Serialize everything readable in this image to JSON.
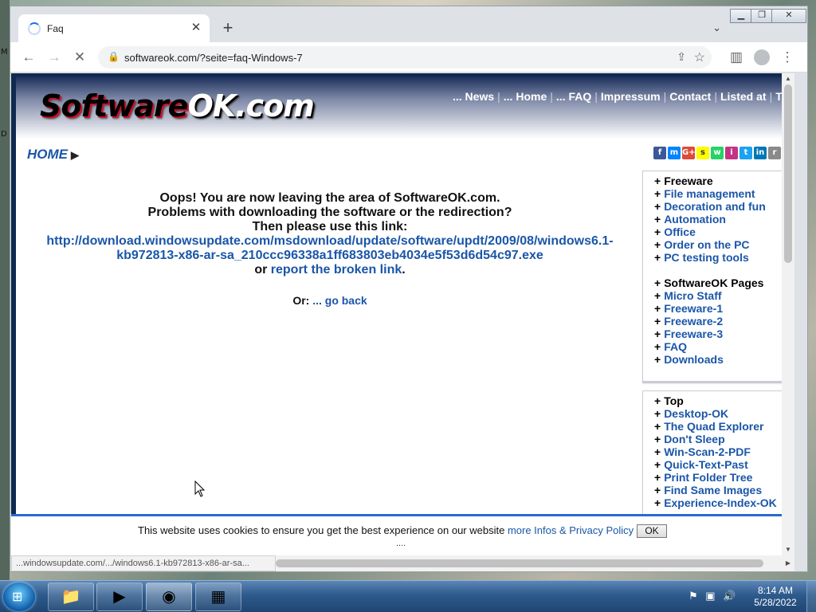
{
  "browser": {
    "tab_title": "Faq",
    "new_tab": "+",
    "url": "softwareok.com/?seite=faq-Windows-7"
  },
  "site": {
    "logo_soft": "Software",
    "logo_ok": "OK.com",
    "nav": [
      {
        "label": "... News"
      },
      {
        "label": "... Home"
      },
      {
        "label": "... FAQ"
      },
      {
        "label": "Impressum"
      },
      {
        "label": "Contact"
      },
      {
        "label": "Listed at"
      },
      {
        "label": "Thank yo"
      }
    ],
    "home_link": "HOME"
  },
  "social": [
    {
      "letter": "f",
      "color": "#3b5998"
    },
    {
      "letter": "m",
      "color": "#0084ff"
    },
    {
      "letter": "G+",
      "color": "#dd4b39"
    },
    {
      "letter": "s",
      "color": "#fffc00"
    },
    {
      "letter": "w",
      "color": "#25d366"
    },
    {
      "letter": "i",
      "color": "#c13584"
    },
    {
      "letter": "t",
      "color": "#1da1f2"
    },
    {
      "letter": "in",
      "color": "#0077b5"
    },
    {
      "letter": "r",
      "color": "#8a8a8a"
    },
    {
      "letter": "★",
      "color": "#f5c518"
    }
  ],
  "message": {
    "line1": "Oops! You are now leaving the area of SoftwareOK.com.",
    "line2": "Problems with downloading the software or the redirection?",
    "line3": "Then please use this link:",
    "link": "http://download.windowsupdate.com/msdownload/update/software/updt/2009/08/windows6.1-kb972813-x86-ar-sa_210ccc96338a1ff683803eb4034e5f53d6d54c97.exe",
    "or": "or",
    "report": "report the broken link",
    "period": ".",
    "or_label": "Or:",
    "go_back": "... go back"
  },
  "sidebar": {
    "box1_head1": "Freeware",
    "box1_links1": [
      "File management",
      "Decoration and fun",
      "Automation",
      "Office",
      "Order on the PC",
      "PC testing tools"
    ],
    "box1_head2": "SoftwareOK Pages",
    "box1_links2": [
      "Micro Staff",
      "Freeware-1",
      "Freeware-2",
      "Freeware-3",
      "FAQ",
      "Downloads"
    ],
    "box2_head": "Top",
    "box2_links": [
      "Desktop-OK",
      "The Quad Explorer",
      "Don't Sleep",
      "Win-Scan-2-PDF",
      "Quick-Text-Past",
      "Print Folder Tree",
      "Find Same Images",
      "Experience-Index-OK"
    ]
  },
  "cookie": {
    "text": "This website uses cookies to ensure you get the best experience on our website",
    "more": "more Infos & Privacy Policy",
    "ok": "OK",
    "dots": "...."
  },
  "status_url": "...windowsupdate.com/.../windows6.1-kb972813-x86-ar-sa...",
  "taskbar": {
    "time": "8:14 AM",
    "date": "5/28/2022"
  },
  "desk_letters": [
    "M",
    "D"
  ]
}
